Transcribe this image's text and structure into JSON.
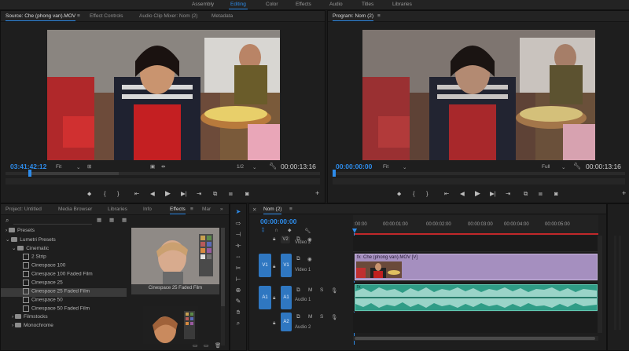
{
  "workspaces": [
    "Assembly",
    "Editing",
    "Color",
    "Effects",
    "Audio",
    "Titles",
    "Libraries"
  ],
  "active_workspace": "Editing",
  "source_panel": {
    "tabs": [
      "Source: Che (phong van).MOV",
      "Effect Controls",
      "Audio Clip Mixer: Nom (2)",
      "Metadata"
    ],
    "timecode_left": "03:41:42:12",
    "fit": "Fit",
    "resolution": "1/2",
    "timecode_right": "00:00:13:16"
  },
  "program_panel": {
    "tab": "Program: Nom (2)",
    "timecode_left": "00:00:00:00",
    "fit": "Fit",
    "resolution": "Full",
    "timecode_right": "00:00:13:16"
  },
  "project_panel": {
    "tabs": [
      "Project: Untitled",
      "Media Browser",
      "Libraries",
      "Info",
      "Effects",
      "Mar"
    ],
    "active_tab": "Effects",
    "tree": [
      {
        "label": "Presets",
        "level": 0,
        "kind": "folder"
      },
      {
        "label": "Lumetri Presets",
        "level": 0,
        "kind": "folder"
      },
      {
        "label": "Cinematic",
        "level": 1,
        "kind": "folder"
      },
      {
        "label": "2 Strip",
        "level": 2,
        "kind": "effect"
      },
      {
        "label": "Cinespace 100",
        "level": 2,
        "kind": "effect"
      },
      {
        "label": "Cinespace 100 Faded Film",
        "level": 2,
        "kind": "effect"
      },
      {
        "label": "Cinespace 25",
        "level": 2,
        "kind": "effect"
      },
      {
        "label": "Cinespace 25 Faded Film",
        "level": 2,
        "kind": "effect",
        "selected": true
      },
      {
        "label": "Cinespace 50",
        "level": 2,
        "kind": "effect"
      },
      {
        "label": "Cinespace 50 Faded Film",
        "level": 2,
        "kind": "effect"
      },
      {
        "label": "Filmstocks",
        "level": 1,
        "kind": "folder"
      },
      {
        "label": "Monochrome",
        "level": 1,
        "kind": "folder"
      }
    ],
    "preview_caption": "Cinespace 25 Faded Film"
  },
  "timeline": {
    "tab": "Nom (2)",
    "timecode": "00:00:00:00",
    "ruler": [
      ":00:00",
      "00:00:01:00",
      "00:00:02:00",
      "00:00:03:00",
      "00:00:04:00",
      "00:00:05:00"
    ],
    "tracks": [
      {
        "id": "V2",
        "name": "Video 2"
      },
      {
        "id": "V1",
        "name": "Video 1",
        "source": "V1"
      },
      {
        "id": "A1",
        "name": "Audio 1",
        "source": "A1"
      },
      {
        "id": "A2",
        "name": "Audio 2"
      }
    ],
    "clip_label": "Che (phong van).MOV [V]",
    "track_buttons": [
      "M",
      "S"
    ]
  }
}
